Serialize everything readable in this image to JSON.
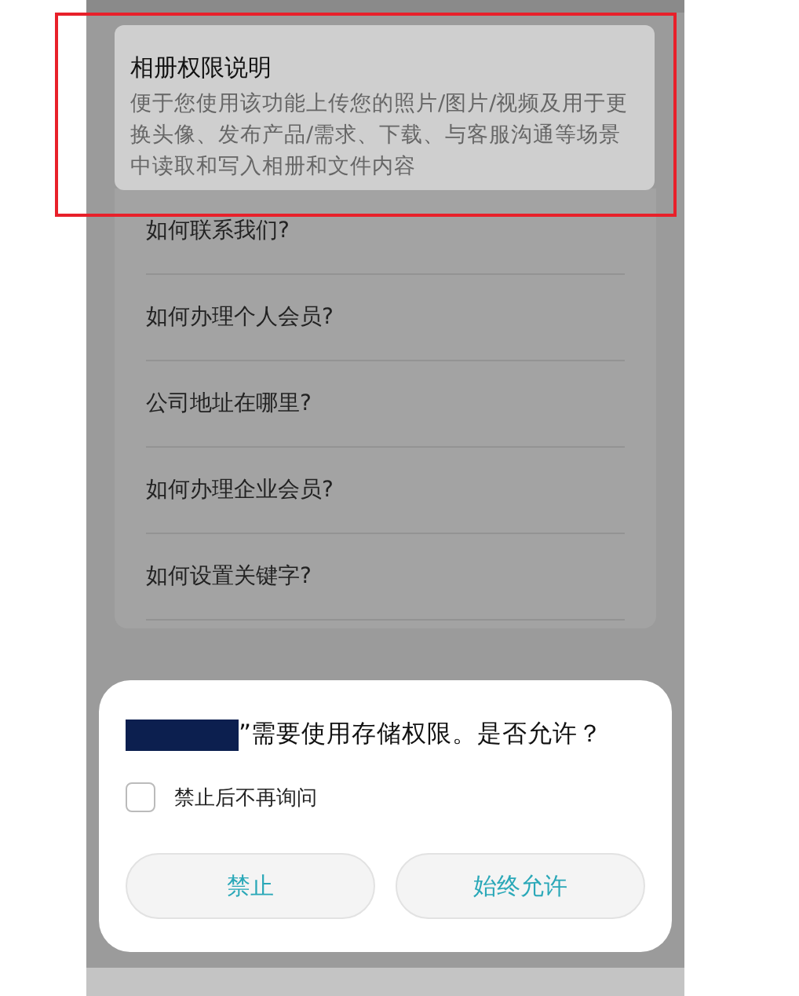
{
  "permission_notice": {
    "title": "相册权限说明",
    "body": "便于您使用该功能上传您的照片/图片/视频及用于更换头像、发布产品/需求、下载、与客服沟通等场景中读取和写入相册和文件内容"
  },
  "faq_items": [
    {
      "label": "如何联系我们?"
    },
    {
      "label": "如何办理个人会员?"
    },
    {
      "label": "公司地址在哪里?"
    },
    {
      "label": "如何办理企业会员?"
    },
    {
      "label": "如何设置关键字?"
    }
  ],
  "dialog": {
    "message": "”需要使用存储权限。是否允许？",
    "dont_ask_again": {
      "label": "禁止后不再询问",
      "checked": false
    },
    "buttons": [
      {
        "label": "禁止"
      },
      {
        "label": "始终允许"
      }
    ]
  }
}
